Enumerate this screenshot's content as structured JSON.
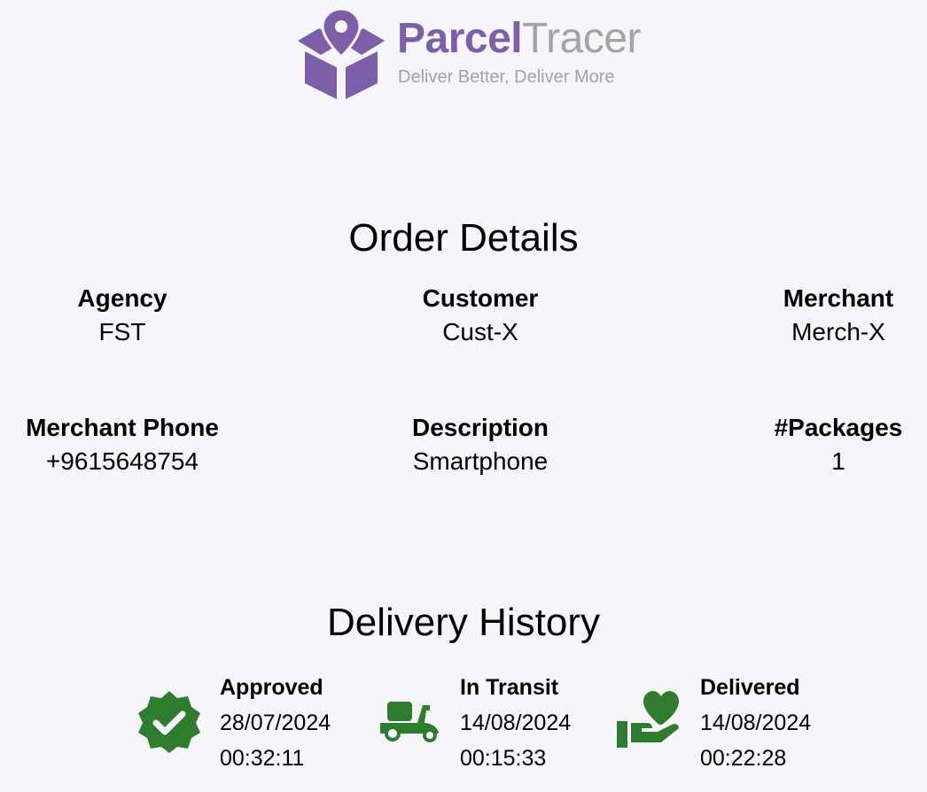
{
  "brand": {
    "name_part1": "Parcel",
    "name_part2": "Tracer",
    "tagline": "Deliver Better, Deliver More",
    "primary_color": "#7d5ea8",
    "secondary_color": "#a3a3a3"
  },
  "order_details": {
    "title": "Order Details",
    "fields": [
      {
        "label": "Agency",
        "value": "FST"
      },
      {
        "label": "Customer",
        "value": "Cust-X"
      },
      {
        "label": "Merchant",
        "value": "Merch-X"
      },
      {
        "label": "Merchant Phone",
        "value": "+9615648754"
      },
      {
        "label": "Description",
        "value": "Smartphone"
      },
      {
        "label": "#Packages",
        "value": "1"
      }
    ]
  },
  "delivery_history": {
    "title": "Delivery History",
    "icon_color": "#2e7d2e",
    "steps": [
      {
        "status": "Approved",
        "date": "28/07/2024",
        "time": "00:32:11",
        "icon": "verified-badge-icon"
      },
      {
        "status": "In Transit",
        "date": "14/08/2024",
        "time": "00:15:33",
        "icon": "scooter-icon"
      },
      {
        "status": "Delivered",
        "date": "14/08/2024",
        "time": "00:22:28",
        "icon": "hand-heart-icon"
      }
    ]
  }
}
